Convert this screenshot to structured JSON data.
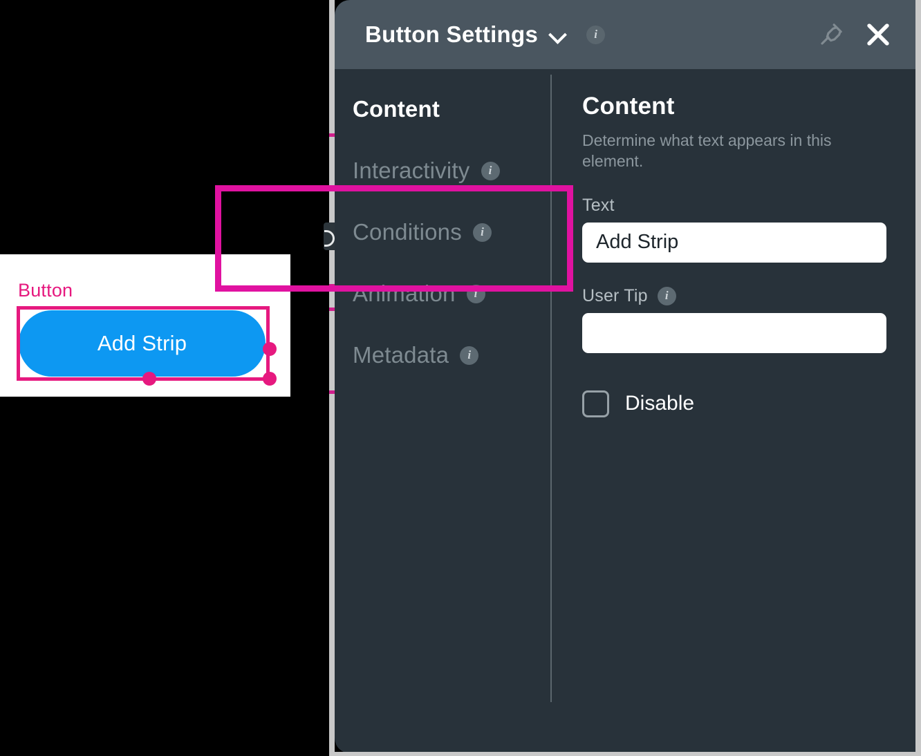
{
  "canvas": {
    "element_label": "Button",
    "button_text": "Add Strip",
    "button_color": "#0d98f2",
    "selection_color": "#e6197f"
  },
  "panel": {
    "title": "Button Settings",
    "title_dropdown_icon": "chevron-down-icon",
    "title_info_icon": "info-icon",
    "pin_icon": "pin-icon",
    "close_icon": "close-icon",
    "header_bg": "#4a5660",
    "body_bg": "#28323a"
  },
  "tabs": [
    {
      "label": "Content",
      "active": true,
      "has_info": false
    },
    {
      "label": "Interactivity",
      "active": false,
      "has_info": true
    },
    {
      "label": "Conditions",
      "active": false,
      "has_info": true
    },
    {
      "label": "Animation",
      "active": false,
      "has_info": true
    },
    {
      "label": "Metadata",
      "active": false,
      "has_info": true
    }
  ],
  "content": {
    "heading": "Content",
    "description": "Determine what text appears in this element.",
    "text_field": {
      "label": "Text",
      "value": "Add Strip",
      "placeholder": ""
    },
    "user_tip_field": {
      "label": "User Tip",
      "value": "",
      "placeholder": "",
      "info_icon": "info-icon"
    },
    "disable_checkbox": {
      "label": "Disable",
      "checked": false
    },
    "highlight_color": "#e012a0"
  },
  "info_glyph": "i"
}
